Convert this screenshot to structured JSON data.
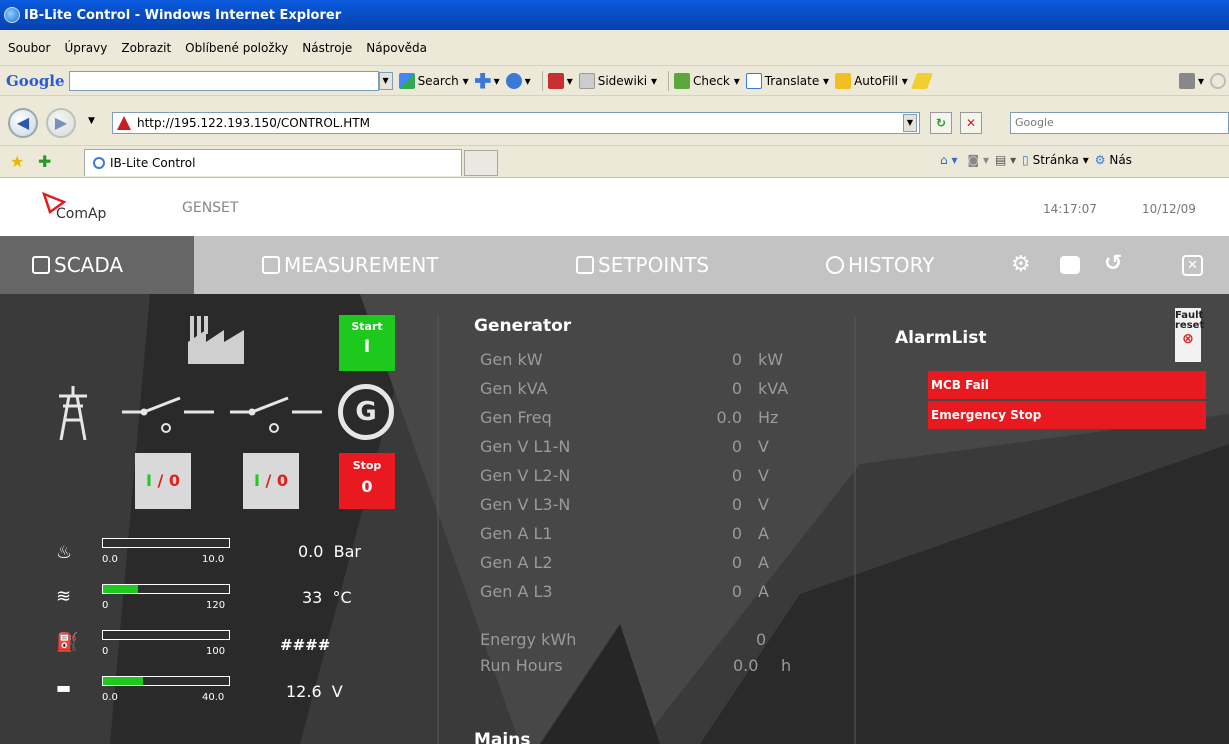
{
  "browser": {
    "window_title": "IB-Lite Control - Windows Internet Explorer",
    "menu": [
      "Soubor",
      "Úpravy",
      "Zobrazit",
      "Oblíbené položky",
      "Nástroje",
      "Nápověda"
    ],
    "google_toolbar": {
      "logo": "Google",
      "search_label": "Search",
      "sidewiki_label": "Sidewiki",
      "check_label": "Check",
      "translate_label": "Translate",
      "autofill_label": "AutoFill"
    },
    "address": "http://195.122.193.150/CONTROL.HTM",
    "search_box": "Google",
    "tab_title": "IB-Lite Control",
    "page_menu": "Stránka",
    "tools_menu": "Nás"
  },
  "app": {
    "brand": "ComAp",
    "section": "GENSET",
    "time": "14:17:07",
    "date": "10/12/09",
    "accent": "#1ec91e",
    "alarm_color": "#e8191f"
  },
  "nav": {
    "scada": "SCADA",
    "measurement": "MEASUREMENT",
    "setpoints": "SETPOINTS",
    "history": "HISTORY"
  },
  "controls": {
    "start_label": "Start",
    "start_symbol": "I",
    "stop_label": "Stop",
    "stop_symbol": "0",
    "mains_breaker": {
      "on": "I",
      "slash": " / ",
      "off": "0"
    },
    "gen_breaker": {
      "on": "I",
      "slash": " / ",
      "off": "0"
    },
    "generator_symbol": "G"
  },
  "gauges": [
    {
      "icon": "oil-pressure-icon",
      "min": "0.0",
      "max": "10.0",
      "fill": 0.0,
      "value": "0.0  Bar"
    },
    {
      "icon": "coolant-temp-icon",
      "min": "0",
      "max": "120",
      "fill": 0.275,
      "value": "33  °C"
    },
    {
      "icon": "fuel-level-icon",
      "min": "0",
      "max": "100",
      "fill": 0.0,
      "value": "####"
    },
    {
      "icon": "battery-icon",
      "min": "0.0",
      "max": "40.0",
      "fill": 0.315,
      "value": "12.6  V"
    }
  ],
  "generator": {
    "title": "Generator",
    "rows": [
      {
        "label": "Gen kW",
        "value": "0",
        "unit": "kW"
      },
      {
        "label": "Gen kVA",
        "value": "0",
        "unit": "kVA"
      },
      {
        "label": "Gen Freq",
        "value": "0.0",
        "unit": "Hz"
      },
      {
        "label": "Gen V L1-N",
        "value": "0",
        "unit": "V"
      },
      {
        "label": "Gen V L2-N",
        "value": "0",
        "unit": "V"
      },
      {
        "label": "Gen V L3-N",
        "value": "0",
        "unit": "V"
      },
      {
        "label": "Gen A L1",
        "value": "0",
        "unit": "A"
      },
      {
        "label": "Gen A L2",
        "value": "0",
        "unit": "A"
      },
      {
        "label": "Gen A L3",
        "value": "0",
        "unit": "A"
      }
    ],
    "energy_label": "Energy kWh",
    "energy_value": "0",
    "run_hours_label": "Run Hours",
    "run_hours_value": "0.0",
    "run_hours_unit": "h",
    "mains_title": "Mains"
  },
  "alarms": {
    "title": "AlarmList",
    "fault_reset": "Fault reset",
    "items": [
      "MCB Fail",
      "Emergency Stop"
    ]
  }
}
